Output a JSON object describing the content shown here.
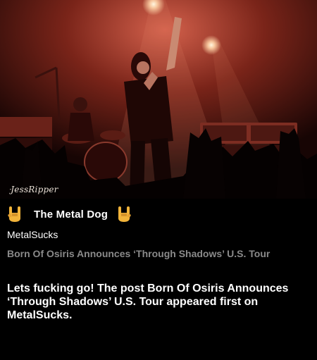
{
  "photo": {
    "subject": "concert-photo",
    "watermark": "JessRipper"
  },
  "brand": {
    "name": "The Metal Dog",
    "left_icon": "rock-hand-icon",
    "right_icon": "rock-hand-icon",
    "icon_color": "#f2b43a"
  },
  "post": {
    "source": "MetalSucks",
    "headline": "Born Of Osiris Announces ‘Through Shadows’ U.S. Tour",
    "body": "Lets fucking go! The post Born Of Osiris Announces ‘Through Shadows’ U.S. Tour appeared first on MetalSucks."
  },
  "colors": {
    "background": "#000000",
    "headline": "#8a8a8a",
    "stage_light": "#c2493a"
  }
}
